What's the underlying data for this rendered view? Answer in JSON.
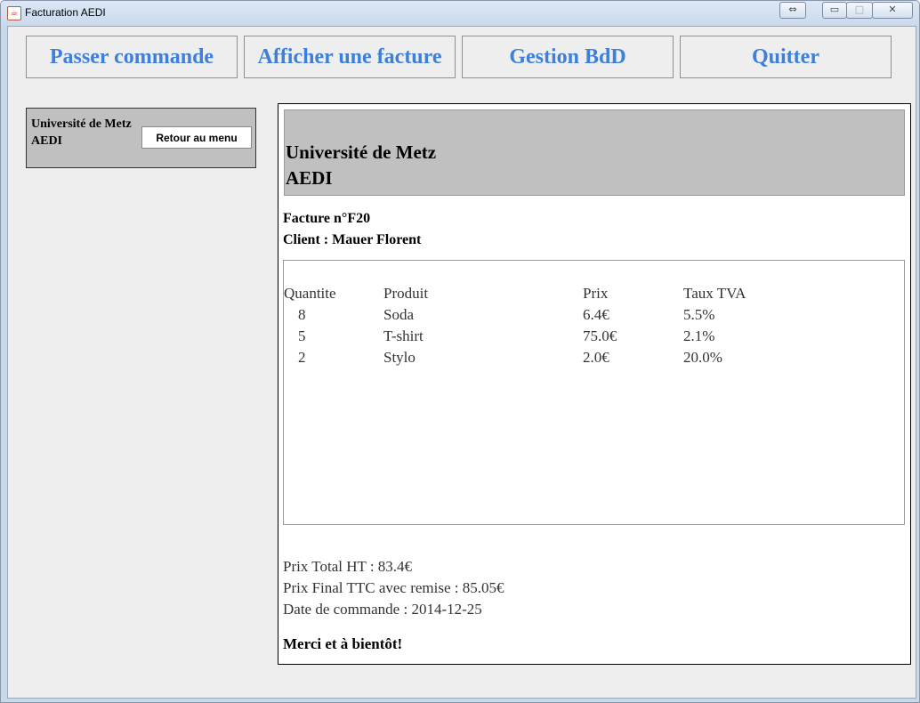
{
  "window": {
    "title": "Facturation AEDI",
    "restore_glyph": "⇔",
    "min_glyph": "▭",
    "max_glyph": "□",
    "close_glyph": "✕"
  },
  "nav": {
    "passer": "Passer commande",
    "afficher": "Afficher une facture",
    "gestion": "Gestion BdD",
    "quitter": "Quitter"
  },
  "side": {
    "org_line1": "Université de Metz",
    "org_line2": "AEDI",
    "retour_label": "Retour au menu"
  },
  "invoice": {
    "org_line1": "Université de Metz",
    "org_line2": "AEDI",
    "number": "Facture n°F20",
    "client": "Client : Mauer Florent",
    "headers": [
      "Quantite",
      "Produit",
      "Prix",
      "Taux TVA"
    ],
    "items": [
      {
        "qty": "8",
        "product": "Soda",
        "price": "6.4€",
        "tva": "5.5%"
      },
      {
        "qty": "5",
        "product": "T-shirt",
        "price": "75.0€",
        "tva": "2.1%"
      },
      {
        "qty": "2",
        "product": "Stylo",
        "price": "2.0€",
        "tva": "20.0%"
      }
    ],
    "total_ht": "Prix Total HT : 83.4€",
    "total_ttc": "Prix Final TTC avec remise : 85.05€",
    "date": "Date de commande : 2014-12-25",
    "thanks": "Merci et à bientôt!"
  },
  "colors": {
    "nav_text": "#3d7fd9",
    "panel_bg": "#eeeeee",
    "header_bg": "#c0c0c0"
  }
}
